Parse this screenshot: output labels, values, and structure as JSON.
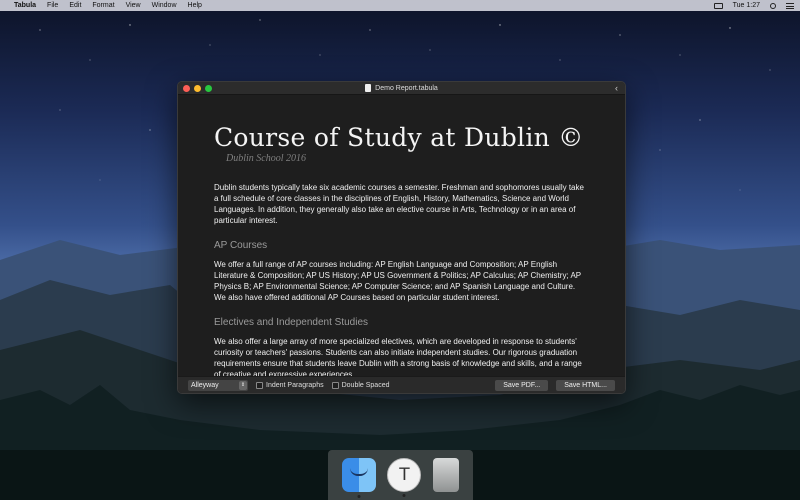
{
  "menubar": {
    "app": "Tabula",
    "items": [
      "File",
      "Edit",
      "Format",
      "View",
      "Window",
      "Help"
    ],
    "clock": "Tue 1:27"
  },
  "window": {
    "title": "Demo Report.tabula"
  },
  "document": {
    "heading": "Course of Study at Dublin ©",
    "subtitle": "Dublin School 2016",
    "intro": "Dublin students typically take six academic courses a semester. Freshman and sophomores usually take a full schedule of core classes in the disciplines of English, History, Mathematics,  Science and World Languages.  In addition, they generally also take an elective course in Arts, Technology or in an area of particular interest.",
    "ap_heading": "AP Courses",
    "ap_text": "We offer a full range of AP courses including: AP English Language and Composition; AP English Literature & Composition; AP US History; AP US Government & Politics; AP Calculus; AP Chemistry; AP Physics B; AP Environmental Science; AP Computer Science; and AP Spanish Language and Culture. We also have offered additional AP Courses based on particular student interest.",
    "electives_heading": "Electives and Independent Studies",
    "electives_text": "We also offer a large array of more specialized electives, which are developed in response to students' curiosity or teachers' passions. Students can also initiate independent studies.  Our rigorous graduation requirements ensure that students leave Dublin with a strong basis of knowledge and skills, and a range of creative and expressive experiences."
  },
  "toolbar": {
    "theme_select": "Alleyway",
    "indent_label": "Indent Paragraphs",
    "double_spaced_label": "Double Spaced",
    "save_pdf": "Save PDF...",
    "save_html": "Save HTML..."
  },
  "dock": {
    "tabula_letter": "T"
  }
}
